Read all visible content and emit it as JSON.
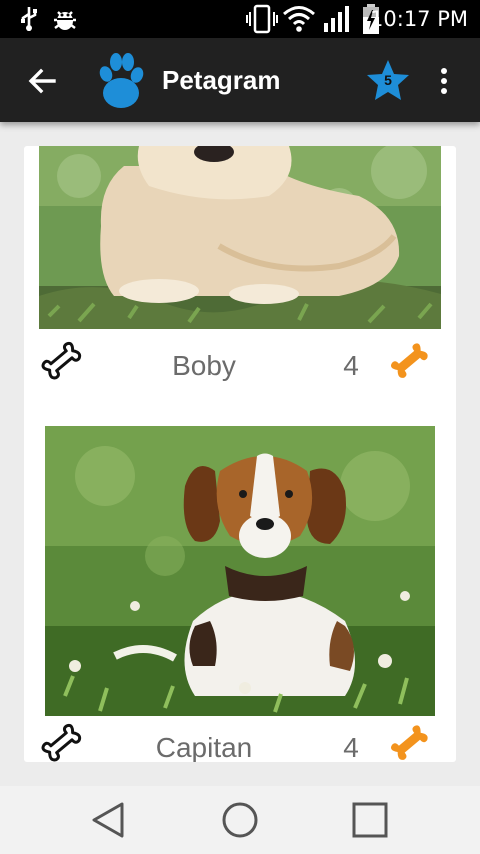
{
  "status_bar": {
    "time": "10:17 PM",
    "icons": [
      "usb-icon",
      "bug-icon",
      "vibrate-icon",
      "wifi-icon",
      "signal-icon",
      "battery-icon"
    ]
  },
  "toolbar": {
    "title": "Petagram",
    "favorites_count": "5",
    "icons": [
      "back-arrow-icon",
      "paw-icon",
      "star-icon",
      "more-vert-icon"
    ],
    "colors": {
      "background": "#212121",
      "paw": "#1e8ed8",
      "star": "#1e8ed8",
      "bone_filled": "#f3931d"
    }
  },
  "pets": [
    {
      "name": "Boby",
      "likes": "4",
      "photo": "fluffy-cream-puppy-photo"
    },
    {
      "name": "Capitan",
      "likes": "4",
      "photo": "beagle-puppy-photo"
    }
  ],
  "nav_bar": {
    "icons": [
      "back-triangle-icon",
      "home-circle-icon",
      "recents-square-icon"
    ]
  }
}
